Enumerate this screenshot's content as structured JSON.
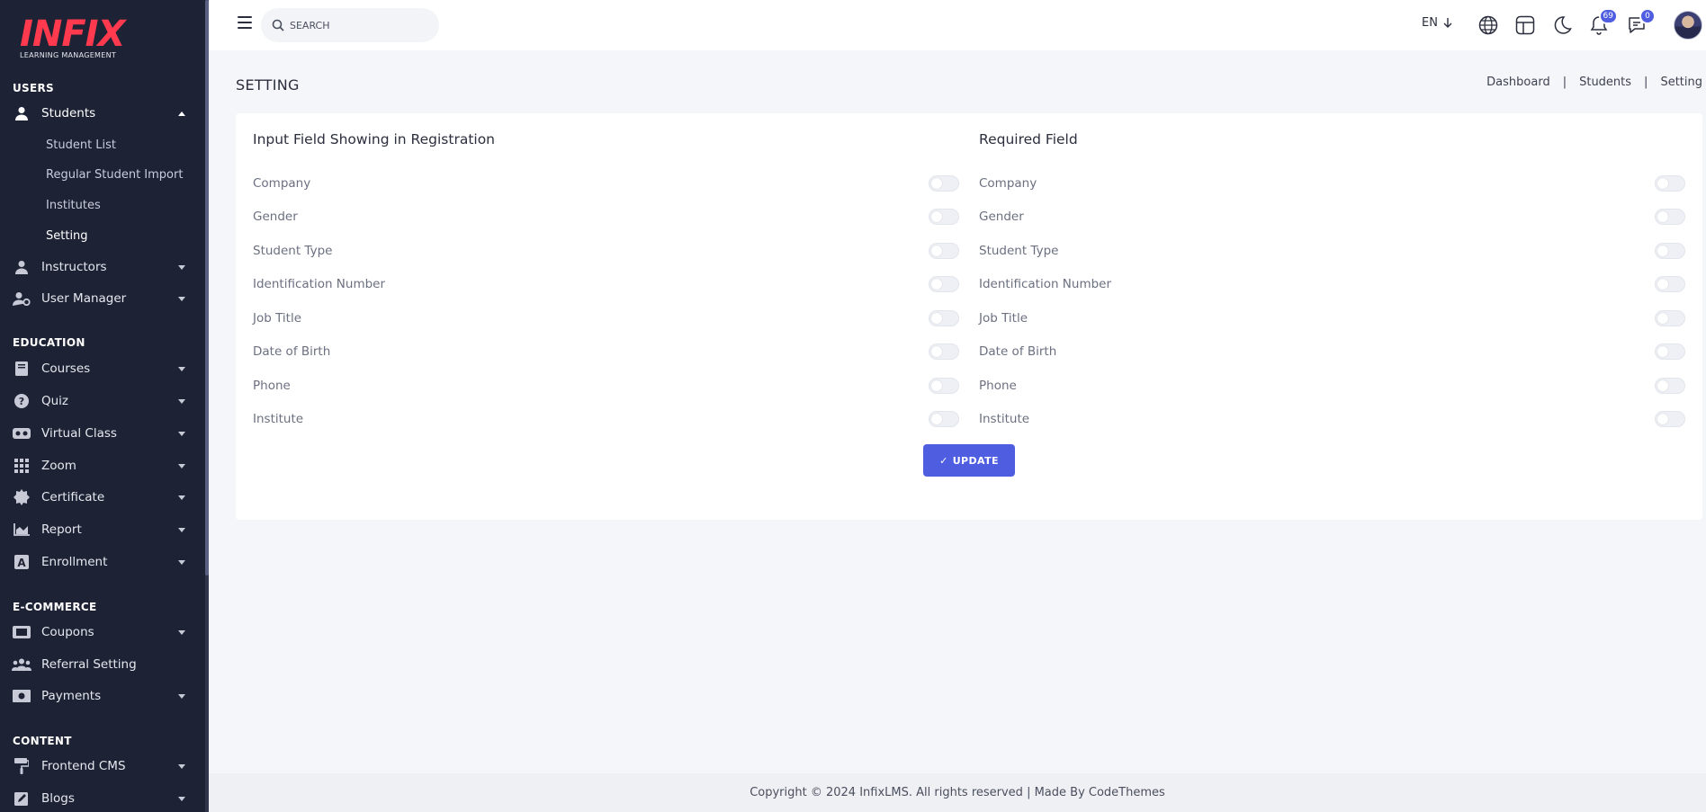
{
  "sidebar": {
    "logo": {
      "text": "INFIX",
      "subtitle": "LEARNING MANAGEMENT"
    },
    "sections": {
      "users": "USERS",
      "education": "EDUCATION",
      "ecommerce": "E-COMMERCE",
      "content": "CONTENT"
    },
    "students": {
      "label": "Students",
      "sub": [
        "Student List",
        "Regular Student Import",
        "Institutes",
        "Setting"
      ]
    },
    "items": {
      "instructors": "Instructors",
      "user_manager": "User Manager",
      "courses": "Courses",
      "quiz": "Quiz",
      "virtual_class": "Virtual Class",
      "zoom": "Zoom",
      "certificate": "Certificate",
      "report": "Report",
      "enrollment": "Enrollment",
      "coupons": "Coupons",
      "referral_setting": "Referral Setting",
      "payments": "Payments",
      "frontend_cms": "Frontend CMS",
      "blogs": "Blogs"
    }
  },
  "header": {
    "search_placeholder": "SEARCH",
    "language": "EN",
    "notifications_count": "69",
    "messages_count": "0"
  },
  "page": {
    "title": "SETTING",
    "breadcrumb": [
      "Dashboard",
      "Students",
      "Setting"
    ],
    "separator": "|"
  },
  "card": {
    "left_title": "Input Field Showing in Registration",
    "right_title": "Required Field",
    "fields": [
      "Company",
      "Gender",
      "Student Type",
      "Identification Number",
      "Job Title",
      "Date of Birth",
      "Phone",
      "Institute"
    ],
    "update_label": "UPDATE",
    "update_icon": "✓"
  },
  "footer": {
    "text": "Copyright © 2024 InfixLMS. All rights reserved | Made By CodeThemes"
  },
  "colors": {
    "sidebar_bg": "#1e2235",
    "accent": "#4f5ee0",
    "logo_red": "#ff3a4e",
    "page_bg": "#f5f6fa"
  }
}
